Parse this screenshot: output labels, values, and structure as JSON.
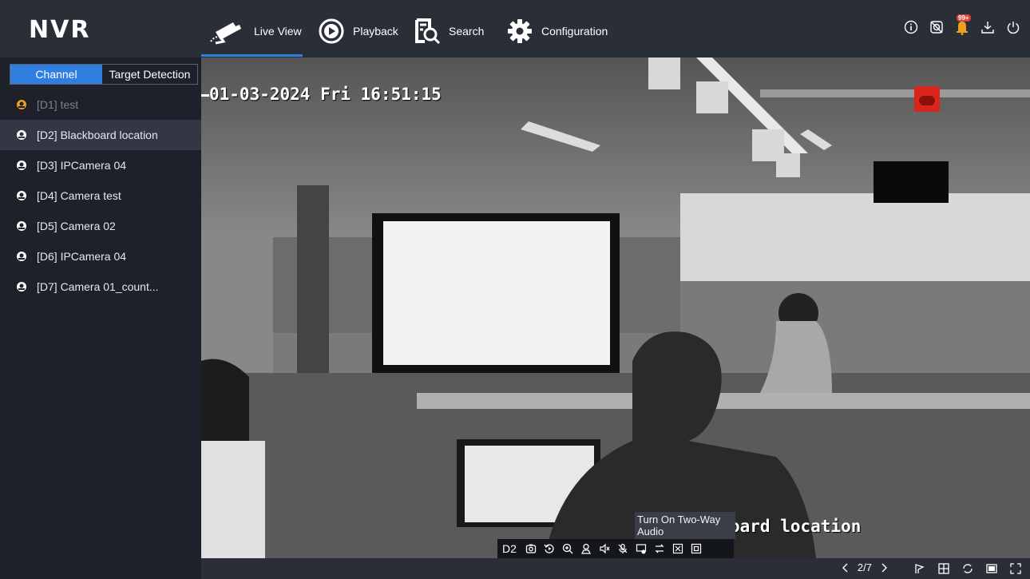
{
  "app": {
    "logo": "NVR"
  },
  "nav": [
    {
      "label": "Live View",
      "icon": "camera-icon",
      "active": true
    },
    {
      "label": "Playback",
      "icon": "play-circle-icon"
    },
    {
      "label": "Search",
      "icon": "search-file-icon"
    },
    {
      "label": "Configuration",
      "icon": "gear-icon"
    }
  ],
  "top_icons": [
    "info-icon",
    "record-off-icon",
    "alarm-bell-icon",
    "download-icon",
    "power-icon"
  ],
  "alarm_badge": "99+",
  "sidebar": {
    "tabs": [
      {
        "label": "Channel",
        "active": true
      },
      {
        "label": "Target Detection",
        "active": false
      }
    ],
    "channels": [
      {
        "label": "[D1] test",
        "state": "offline"
      },
      {
        "label": "[D2] Blackboard location",
        "state": "selected"
      },
      {
        "label": "[D3] IPCamera 04",
        "state": "online"
      },
      {
        "label": "[D4] Camera test",
        "state": "online"
      },
      {
        "label": "[D5] Camera 02",
        "state": "online"
      },
      {
        "label": "[D6] IPCamera 04",
        "state": "online"
      },
      {
        "label": "[D7] Camera 01_count...",
        "state": "online"
      }
    ]
  },
  "video": {
    "osd_time": "01-03-2024 Fri 16:51:15",
    "osd_name": "oard location",
    "recording": true
  },
  "toolbar": {
    "channel_label": "D2",
    "tooltip": "Turn On Two-Way Audio",
    "buttons": [
      "snapshot-icon",
      "instant-playback-icon",
      "zoom-icon",
      "ptz-icon",
      "mute-icon",
      "microphone-icon",
      "alarm-output-icon",
      "switch-stream-icon",
      "close-preview-icon",
      "fit-window-icon"
    ]
  },
  "bottom": {
    "page": "2/7",
    "icons": [
      "previous-page-icon",
      "next-page-icon",
      "sequence-icon",
      "layout-icon",
      "refresh-icon",
      "single-screen-icon",
      "fullscreen-icon"
    ]
  },
  "colors": {
    "accent": "#2f7fe0",
    "topbar": "#2a2e37",
    "sidebar": "#1e2129",
    "selected_row": "#323743",
    "alarm": "#e0403a"
  }
}
